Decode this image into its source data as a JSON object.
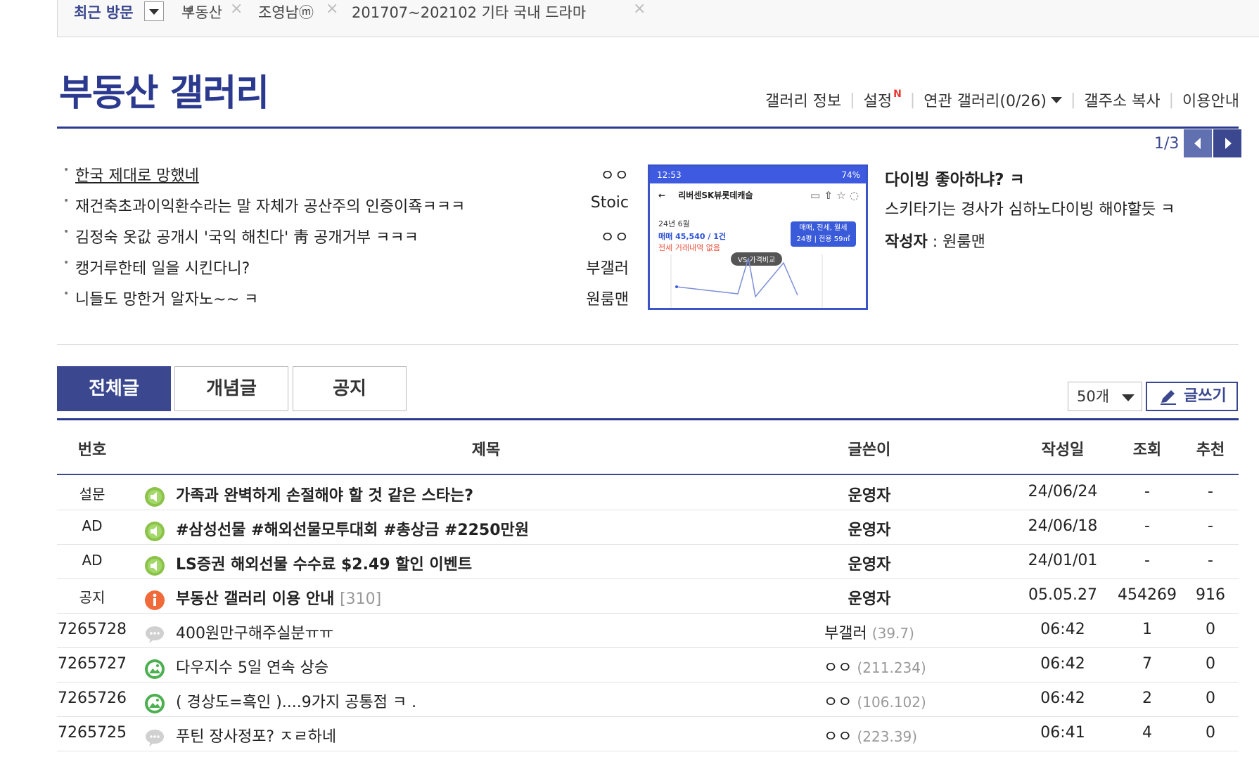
{
  "recent": {
    "label": "최근 방문",
    "items": [
      "부동산",
      "조영남ⓜ",
      "201707~202102 기타 국내 드라마"
    ],
    "close_glyph": "×"
  },
  "gallery": {
    "title": "부동산 갤러리",
    "menu": {
      "info": "갤러리 정보",
      "settings": "설정",
      "settings_badge": "N",
      "related": "연관 갤러리(0/26)",
      "copy_address": "갤주소 복사",
      "guide": "이용안내"
    }
  },
  "hot": {
    "page": "1/3",
    "items": [
      {
        "title": "한국 제대로 망했네",
        "writer": "ㅇㅇ"
      },
      {
        "title": "재건축초과이익환수라는 말 자체가 공산주의 인증이죡ㅋㅋㅋ",
        "writer": "Stoic"
      },
      {
        "title": "김정숙 옷값 공개시 '국익 해친다' 靑 공개거부 ㅋㅋㅋ",
        "writer": "ㅇㅇ"
      },
      {
        "title": "캥거루한테 일을 시킨다니?",
        "writer": "부갤러"
      },
      {
        "title": "니들도 망한거 알자노~~ ㅋ",
        "writer": "원룸맨"
      }
    ],
    "thumb": {
      "status_time": "12:53",
      "status_right": "74%",
      "nav_title": "리버센SK뷰롯데캐슬",
      "month": "24년 6월",
      "trade": "매매 45,540 / 1건",
      "rent": "전세 거래내역 없음",
      "tag_line1": "매매, 전세, 월세",
      "tag_line2": "24평 | 전용 59㎡",
      "vs": "VS 가격비교"
    },
    "featured": {
      "title": "다이빙 좋아하냐? ㅋ",
      "desc": "스키타기는 경사가 심하노다이빙 해야할듯 ㅋ",
      "author_label": "작성자",
      "author_sep": " : ",
      "author": "원룸맨"
    }
  },
  "tabs": [
    "전체글",
    "개념글",
    "공지"
  ],
  "list_controls": {
    "count": "50개",
    "write": "글쓰기"
  },
  "columns": {
    "num": "번호",
    "title": "제목",
    "writer": "글쓴이",
    "date": "작성일",
    "views": "조회",
    "recommend": "추천"
  },
  "colors": {
    "accent": "#3b4890",
    "speaker": "#8bc34a",
    "notice": "#f06a3a",
    "image_post": "#4caf50"
  },
  "rows": [
    {
      "num": "설문",
      "icon": "speaker-icon",
      "title": "가족과 완벽하게 손절해야 할 것 같은 스타는?",
      "reply": "",
      "writer": "운영자",
      "ip": "",
      "date": "24/06/24",
      "views": "-",
      "rec": "-"
    },
    {
      "num": "AD",
      "icon": "speaker-icon",
      "title": "#삼성선물 #해외선물모투대회 #총상금 #2250만원",
      "reply": "",
      "writer": "운영자",
      "ip": "",
      "date": "24/06/18",
      "views": "-",
      "rec": "-"
    },
    {
      "num": "AD",
      "icon": "speaker-icon",
      "title": "LS증권 해외선물 수수료 $2.49 할인 이벤트",
      "reply": "",
      "writer": "운영자",
      "ip": "",
      "date": "24/01/01",
      "views": "-",
      "rec": "-"
    },
    {
      "num": "공지",
      "icon": "notice-icon",
      "title": "부동산 갤러리 이용 안내",
      "reply": "[310]",
      "writer": "운영자",
      "ip": "",
      "date": "05.05.27",
      "views": "454269",
      "rec": "916"
    },
    {
      "num": "7265728",
      "icon": "chat-icon",
      "title": "400원만구해주실분ㅠㅠ",
      "reply": "",
      "writer": "부갤러",
      "ip": "(39.7)",
      "date": "06:42",
      "views": "1",
      "rec": "0"
    },
    {
      "num": "7265727",
      "icon": "image-icon",
      "title": "다우지수 5일 연속 상승",
      "reply": "",
      "writer": "ㅇㅇ",
      "ip": "(211.234)",
      "date": "06:42",
      "views": "7",
      "rec": "0"
    },
    {
      "num": "7265726",
      "icon": "image-icon",
      "title": "( 경상도=흑인 )....9가지 공통점 ㅋ .",
      "reply": "",
      "writer": "ㅇㅇ",
      "ip": "(106.102)",
      "date": "06:42",
      "views": "2",
      "rec": "0"
    },
    {
      "num": "7265725",
      "icon": "chat-icon",
      "title": "푸틴 장사정포? ㅈㄹ하네",
      "reply": "",
      "writer": "ㅇㅇ",
      "ip": "(223.39)",
      "date": "06:41",
      "views": "4",
      "rec": "0"
    }
  ]
}
